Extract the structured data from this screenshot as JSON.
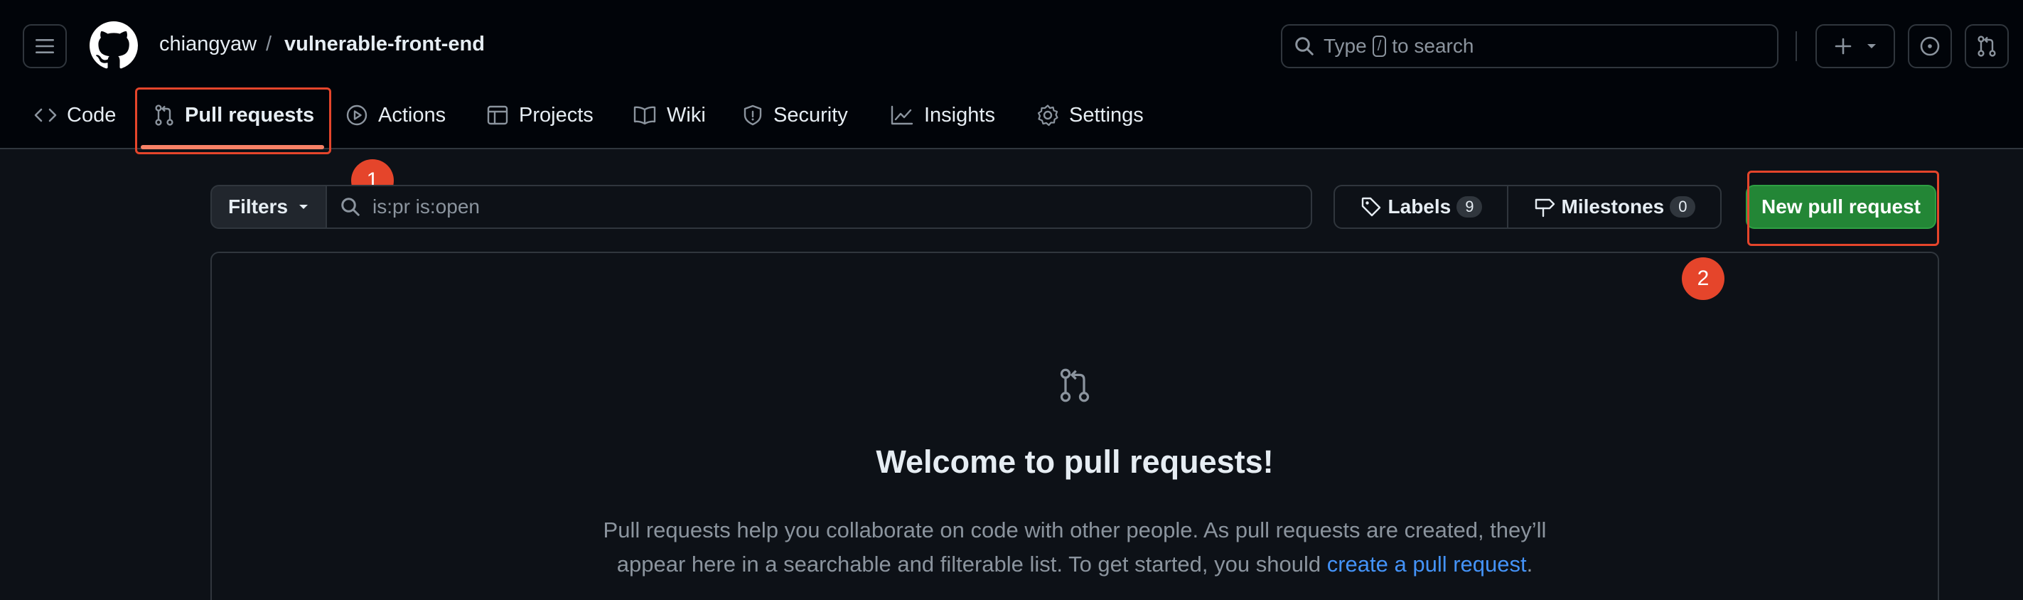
{
  "header": {
    "owner": "chiangyaw",
    "separator": "/",
    "repo": "vulnerable-front-end",
    "search": {
      "before": "Type",
      "key": "/",
      "after": "to search"
    },
    "icons": [
      "hamburger-icon",
      "github-logo",
      "plus-icon",
      "caret-down-icon",
      "issue-opened-icon",
      "git-pull-request-icon"
    ]
  },
  "nav": {
    "code": "Code",
    "pull_requests": "Pull requests",
    "actions": "Actions",
    "projects": "Projects",
    "wiki": "Wiki",
    "security": "Security",
    "insights": "Insights",
    "settings": "Settings"
  },
  "annotations": {
    "one": "1",
    "two": "2",
    "color": "#e5452b"
  },
  "toolbar": {
    "filters": "Filters",
    "filter_value": "is:pr is:open",
    "labels": "Labels",
    "labels_count": "9",
    "milestones": "Milestones",
    "milestones_count": "0",
    "new_pull_request": "New pull request"
  },
  "blankslate": {
    "title": "Welcome to pull requests!",
    "description": "Pull requests help you collaborate on code with other people. As pull requests are created, they’ll appear here in a searchable and filterable list. To get started, you should",
    "link": "create a pull request",
    "period": "."
  },
  "colors": {
    "accent_green": "#238636",
    "link_blue": "#4493f8",
    "underline_orange": "#f78166",
    "background": "#0d1117"
  }
}
